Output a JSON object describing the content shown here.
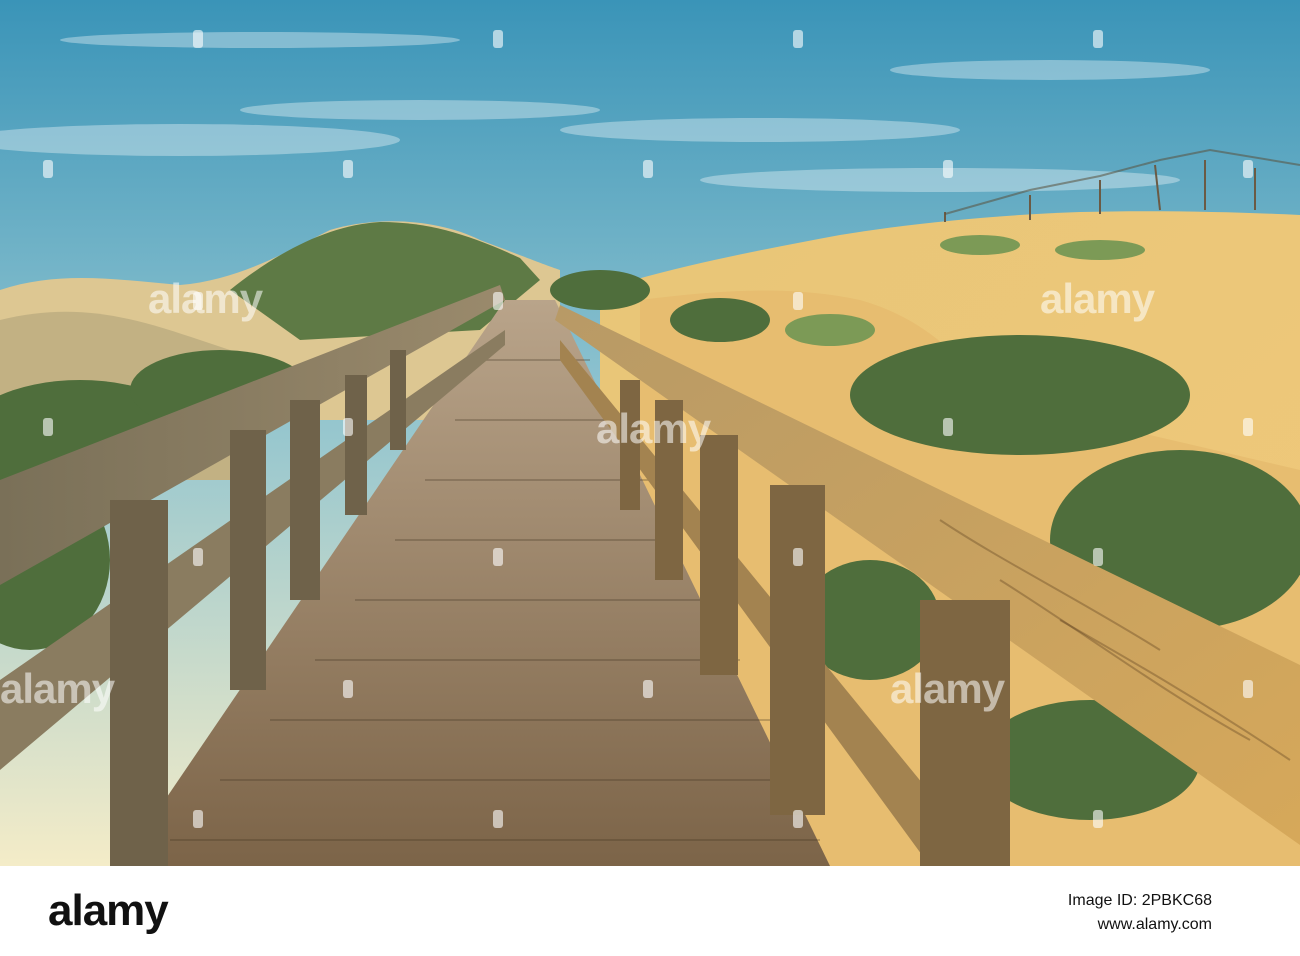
{
  "image": {
    "description_colors": {
      "sky_top": "#3a94b8",
      "sky_horizon": "#f4ecc8",
      "sand": "#e8c278",
      "wood": "#8a6e50",
      "shrub": "#4f6e3c"
    }
  },
  "watermark": {
    "text": "alamy"
  },
  "footer": {
    "logo": "alamy",
    "image_id": "Image ID: 2PBKC68",
    "url": "www.alamy.com"
  }
}
